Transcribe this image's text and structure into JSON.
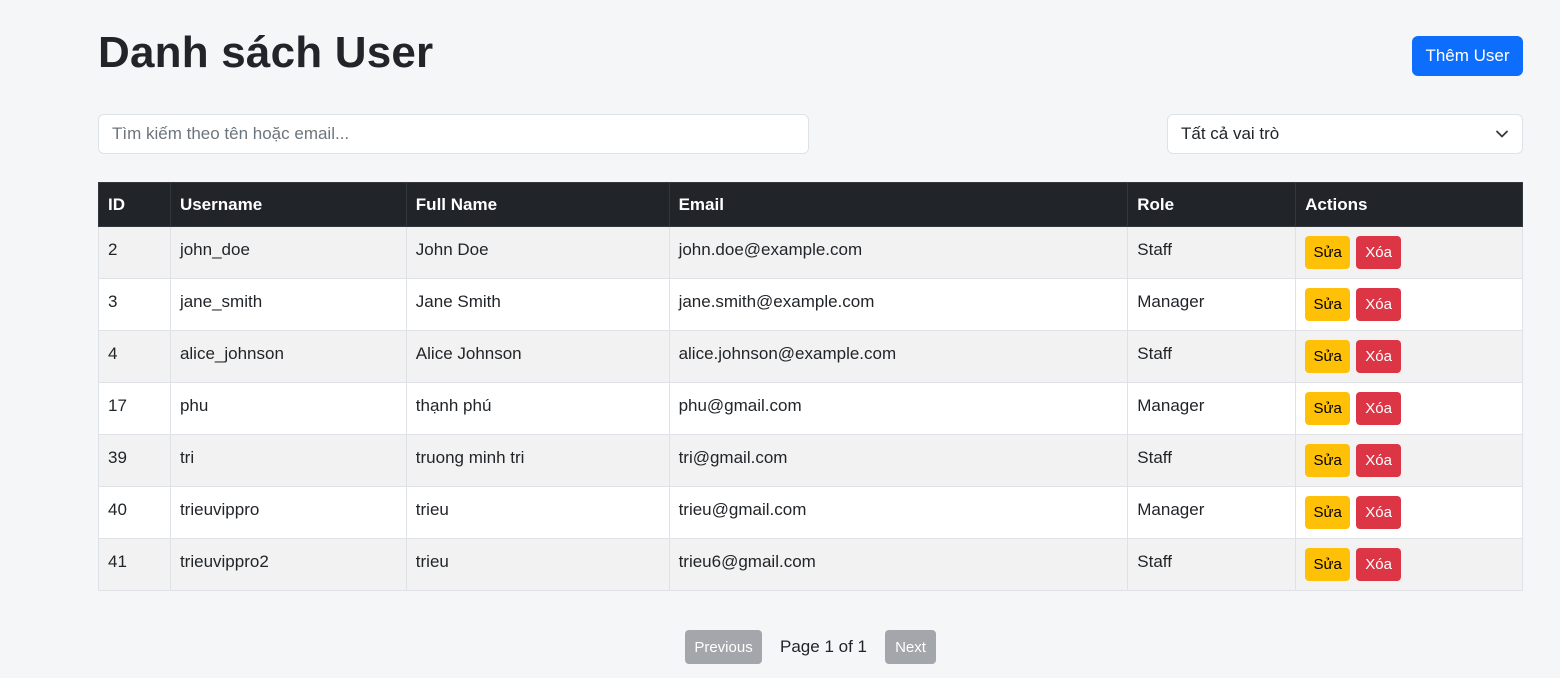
{
  "header": {
    "title": "Danh sách User",
    "add_button_label": "Thêm User"
  },
  "filters": {
    "search_placeholder": "Tìm kiếm theo tên hoặc email...",
    "search_value": "",
    "role_selected": "Tất cả vai trò"
  },
  "table": {
    "columns": [
      "ID",
      "Username",
      "Full Name",
      "Email",
      "Role",
      "Actions"
    ],
    "edit_label": "Sửa",
    "delete_label": "Xóa",
    "rows": [
      {
        "id": "2",
        "username": "john_doe",
        "full_name": "John Doe",
        "email": "john.doe@example.com",
        "role": "Staff"
      },
      {
        "id": "3",
        "username": "jane_smith",
        "full_name": "Jane Smith",
        "email": "jane.smith@example.com",
        "role": "Manager"
      },
      {
        "id": "4",
        "username": "alice_johnson",
        "full_name": "Alice Johnson",
        "email": "alice.johnson@example.com",
        "role": "Staff"
      },
      {
        "id": "17",
        "username": "phu",
        "full_name": "thạnh phú",
        "email": "phu@gmail.com",
        "role": "Manager"
      },
      {
        "id": "39",
        "username": "tri",
        "full_name": "truong minh tri",
        "email": "tri@gmail.com",
        "role": "Staff"
      },
      {
        "id": "40",
        "username": "trieuvippro",
        "full_name": "trieu",
        "email": "trieu@gmail.com",
        "role": "Manager"
      },
      {
        "id": "41",
        "username": "trieuvippro2",
        "full_name": "trieu",
        "email": "trieu6@gmail.com",
        "role": "Staff"
      }
    ]
  },
  "pagination": {
    "previous_label": "Previous",
    "page_info": "Page 1 of 1",
    "next_label": "Next"
  },
  "colors": {
    "primary": "#0d6efd",
    "warning": "#ffc107",
    "danger": "#dc3545",
    "table_header": "#212529",
    "disabled": "#a3a6aa"
  },
  "icons": {
    "role_select_indicator": "chevron-down-icon"
  }
}
